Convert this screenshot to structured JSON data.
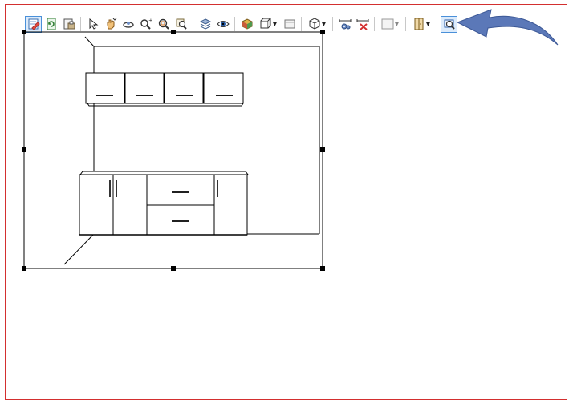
{
  "window": {
    "border_color": "#d32f2f"
  },
  "toolbar": {
    "buttons": [
      {
        "icon": "edit-document-icon",
        "state": "active"
      },
      {
        "icon": "refresh-icon"
      },
      {
        "icon": "print-preview-icon"
      },
      {
        "icon": "select-pointer-icon"
      },
      {
        "icon": "pan-hand-icon"
      },
      {
        "icon": "orbit-rotate-icon"
      },
      {
        "icon": "zoom-in-out-icon"
      },
      {
        "icon": "zoom-window-icon"
      },
      {
        "icon": "zoom-previous-icon"
      },
      {
        "icon": "layers-icon"
      },
      {
        "icon": "visibility-eye-icon"
      },
      {
        "icon": "render-shading-icon"
      },
      {
        "icon": "view-projection-dropdown-icon"
      },
      {
        "icon": "panel-view-icon"
      },
      {
        "icon": "3d-box-dropdown-icon"
      },
      {
        "icon": "dimension-settings-icon"
      },
      {
        "icon": "delete-dimension-icon"
      },
      {
        "icon": "fill-color-dropdown-icon"
      },
      {
        "icon": "door-style-dropdown-icon"
      },
      {
        "icon": "zoom-extents-icon",
        "state": "highlighted"
      }
    ]
  },
  "annotation": {
    "arrow_color": "#5b78b8",
    "points_to": "zoom-extents-icon"
  },
  "drawing": {
    "description_visible": false
  }
}
